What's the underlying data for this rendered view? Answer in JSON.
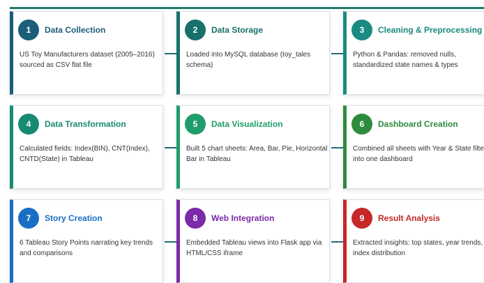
{
  "steps": [
    {
      "num": "1",
      "title": "Data Collection",
      "desc": "US Toy Manufacturers dataset (2005–2016) sourced as CSV flat file",
      "color": "#1b5e7a"
    },
    {
      "num": "2",
      "title": "Data Storage",
      "desc": "Loaded into MySQL database (toy_tales schema)",
      "color": "#17706a"
    },
    {
      "num": "3",
      "title": "Cleaning & Preprocessing",
      "desc": "Python & Pandas: removed nulls, standardized state names & types",
      "color": "#1a8b80"
    },
    {
      "num": "4",
      "title": "Data Transformation",
      "desc": "Calculated fields: Index(BIN), CNT(Index), CNTD(State) in Tableau",
      "color": "#178a72"
    },
    {
      "num": "5",
      "title": "Data Visualization",
      "desc": "Built 5 chart sheets: Area, Bar, Pie, Horizontal Bar in Tableau",
      "color": "#1f9d6a"
    },
    {
      "num": "6",
      "title": "Dashboard Creation",
      "desc": "Combined all sheets with Year & State filters into one dashboard",
      "color": "#2e8b3e"
    },
    {
      "num": "7",
      "title": "Story Creation",
      "desc": "6 Tableau Story Points narrating key trends and comparisons",
      "color": "#1a6fc4"
    },
    {
      "num": "8",
      "title": "Web Integration",
      "desc": "Embedded Tableau views into Flask app via HTML/CSS iframe",
      "color": "#7b2aa8"
    },
    {
      "num": "9",
      "title": "Result Analysis",
      "desc": "Extracted insights: top states, year trends, index distribution",
      "color": "#c62828"
    }
  ]
}
